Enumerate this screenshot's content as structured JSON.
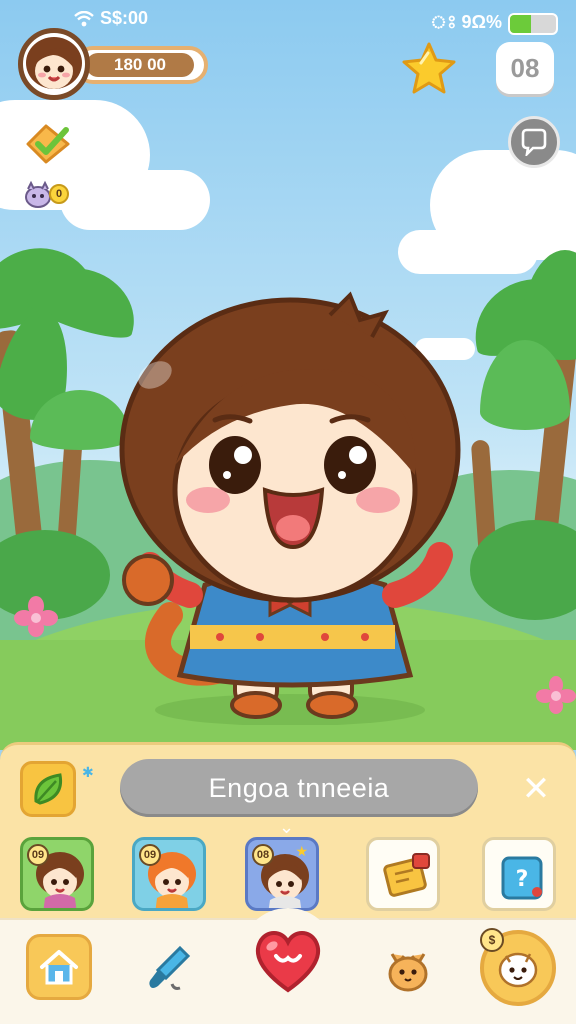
{
  "status_bar": {
    "time": "S$:00",
    "signal_label": "ঃ 9Ω%",
    "battery_level": 0.45
  },
  "hud": {
    "coins": "180 00",
    "side_badge_count": "0",
    "exit_button_label": "08"
  },
  "panel": {
    "title": "Engoa tnneeia",
    "slots": [
      {
        "badge": "09",
        "bg": "#8fd56a",
        "border": "#5aa33c"
      },
      {
        "badge": "09",
        "bg": "#7fd0e6",
        "border": "#4aa8c4"
      },
      {
        "badge": "08",
        "bg": "#8aa9e8",
        "border": "#5a79c4"
      },
      {
        "badge": "",
        "bg": "#fffdf5",
        "border": "#e0cfa0"
      },
      {
        "badge": "",
        "bg": "#fffdf5",
        "border": "#e0cfa0"
      }
    ]
  },
  "nav": {
    "items": [
      "home-icon",
      "paintbrush-icon",
      "heart-icon",
      "pet-icon",
      "friend-icon"
    ],
    "friend_badge": "$"
  },
  "colors": {
    "sky": "#8ccaf0",
    "grass": "#8fd164",
    "panel": "#fbe3a6",
    "accent": "#f8c441"
  }
}
